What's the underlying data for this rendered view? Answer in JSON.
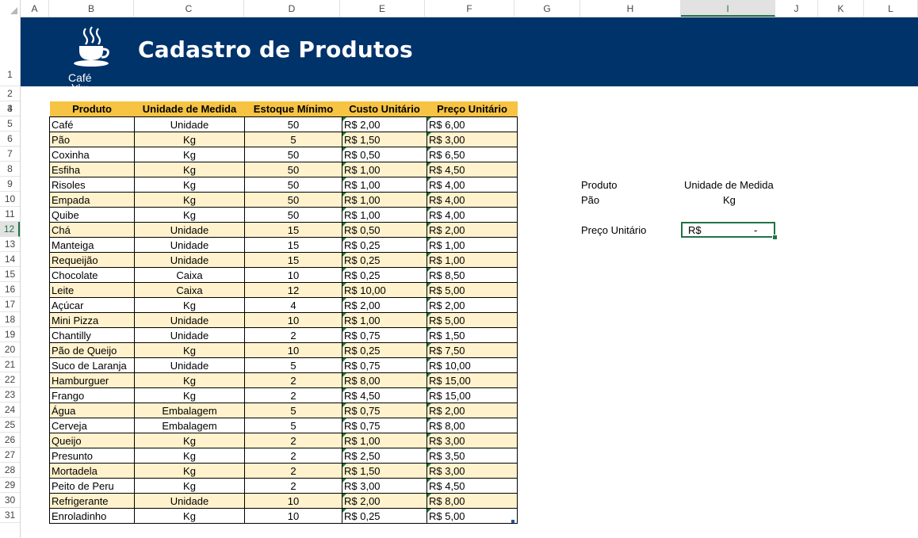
{
  "columns": [
    "A",
    "B",
    "C",
    "D",
    "E",
    "F",
    "G",
    "H",
    "I",
    "J",
    "K",
    "L"
  ],
  "rows": [
    "1",
    "2",
    "3",
    "4",
    "5",
    "6",
    "7",
    "8",
    "9",
    "10",
    "11",
    "12",
    "13",
    "14",
    "15",
    "16",
    "17",
    "18",
    "19",
    "20",
    "21",
    "22",
    "23",
    "24",
    "25",
    "26",
    "27",
    "28",
    "29",
    "30",
    "31"
  ],
  "banner": {
    "title": "Cadastro de Produtos",
    "logo_icon": "coffee-cup-icon",
    "logo_text": "Café",
    "logo_subtext": "Cl..."
  },
  "table": {
    "headers": [
      "Produto",
      "Unidade de Medida",
      "Estoque Mínimo",
      "Custo Unitário",
      "Preço Unitário"
    ],
    "rows": [
      [
        "Café",
        "Unidade",
        "50",
        "R$ 2,00",
        "R$ 6,00"
      ],
      [
        "Pão",
        "Kg",
        "5",
        "R$ 1,50",
        "R$ 3,00"
      ],
      [
        "Coxinha",
        "Kg",
        "50",
        "R$ 0,50",
        "R$ 6,50"
      ],
      [
        "Esfiha",
        "Kg",
        "50",
        "R$ 1,00",
        "R$ 4,50"
      ],
      [
        "Risoles",
        "Kg",
        "50",
        "R$ 1,00",
        "R$ 4,00"
      ],
      [
        "Empada",
        "Kg",
        "50",
        "R$ 1,00",
        "R$ 4,00"
      ],
      [
        "Quibe",
        "Kg",
        "50",
        "R$ 1,00",
        "R$ 4,00"
      ],
      [
        "Chá",
        "Unidade",
        "15",
        "R$ 0,50",
        "R$ 2,00"
      ],
      [
        "Manteiga",
        "Unidade",
        "15",
        "R$ 0,25",
        "R$ 1,00"
      ],
      [
        "Requeijão",
        "Unidade",
        "15",
        "R$ 0,25",
        "R$ 1,00"
      ],
      [
        "Chocolate",
        "Caixa",
        "10",
        "R$ 0,25",
        "R$ 8,50"
      ],
      [
        "Leite",
        "Caixa",
        "12",
        "R$ 10,00",
        "R$ 5,00"
      ],
      [
        "Açúcar",
        "Kg",
        "4",
        "R$ 2,00",
        "R$ 2,00"
      ],
      [
        "Mini Pizza",
        "Unidade",
        "10",
        "R$ 1,00",
        "R$ 5,00"
      ],
      [
        "Chantilly",
        "Unidade",
        "2",
        "R$ 0,75",
        "R$ 1,50"
      ],
      [
        "Pão de Queijo",
        "Kg",
        "10",
        "R$ 0,25",
        "R$ 7,50"
      ],
      [
        "Suco de Laranja",
        "Unidade",
        "5",
        "R$ 0,75",
        "R$ 10,00"
      ],
      [
        "Hamburguer",
        "Kg",
        "2",
        "R$ 8,00",
        "R$ 15,00"
      ],
      [
        "Frango",
        "Kg",
        "2",
        "R$ 4,50",
        "R$ 15,00"
      ],
      [
        "Água",
        "Embalagem",
        "5",
        "R$ 0,75",
        "R$ 2,00"
      ],
      [
        "Cerveja",
        "Embalagem",
        "5",
        "R$ 0,75",
        "R$ 8,00"
      ],
      [
        "Queijo",
        "Kg",
        "2",
        "R$ 1,00",
        "R$ 3,00"
      ],
      [
        "Presunto",
        "Kg",
        "2",
        "R$ 2,50",
        "R$ 3,50"
      ],
      [
        "Mortadela",
        "Kg",
        "2",
        "R$ 1,50",
        "R$ 3,00"
      ],
      [
        "Peito de Peru",
        "Kg",
        "2",
        "R$ 3,00",
        "R$ 4,50"
      ],
      [
        "Refrigerante",
        "Unidade",
        "10",
        "R$ 2,00",
        "R$ 8,00"
      ],
      [
        "Enroladinho",
        "Kg",
        "10",
        "R$ 0,25",
        "R$ 5,00"
      ]
    ]
  },
  "lookup": {
    "produto_label": "Produto",
    "unidade_label": "Unidade de Medida",
    "produto_value": "Pão",
    "unidade_value": "Kg",
    "preco_label": "Preço Unitário",
    "preco_currency": "R$",
    "preco_value": "-"
  },
  "selected_cell": "I12",
  "colors": {
    "banner": "#00336a",
    "header_fill": "#f6c343",
    "alt_row": "#fff2cc",
    "selection": "#217346"
  }
}
